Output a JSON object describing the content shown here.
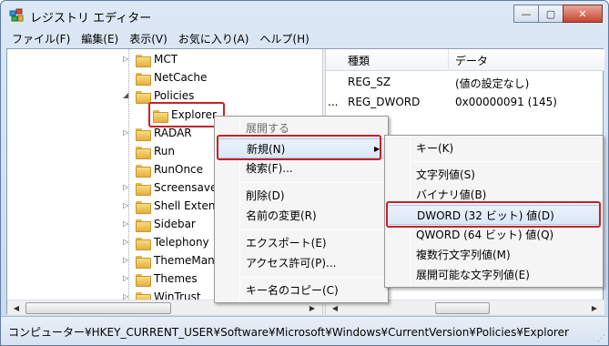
{
  "window": {
    "title": "レジストリ エディター",
    "buttons": {
      "minimize": "—",
      "maximize": "▢",
      "close": "✕"
    }
  },
  "menubar": [
    "ファイル(F)",
    "編集(E)",
    "表示(V)",
    "お気に入り(A)",
    "ヘルプ(H)"
  ],
  "tree": {
    "items": [
      {
        "label": "MCT",
        "expander": "▷"
      },
      {
        "label": "NetCache",
        "expander": ""
      },
      {
        "label": "Policies",
        "expander": "◢"
      },
      {
        "label": "Explorer",
        "expander": ""
      },
      {
        "label": "RADAR",
        "expander": "▷"
      },
      {
        "label": "Run",
        "expander": ""
      },
      {
        "label": "RunOnce",
        "expander": ""
      },
      {
        "label": "Screensave",
        "expander": "▷"
      },
      {
        "label": "Shell Extens",
        "expander": "▷"
      },
      {
        "label": "Sidebar",
        "expander": "▷"
      },
      {
        "label": "Telephony",
        "expander": "▷"
      },
      {
        "label": "ThemeMana",
        "expander": "▷"
      },
      {
        "label": "Themes",
        "expander": "▷"
      },
      {
        "label": "WinTrust",
        "expander": "▷"
      }
    ]
  },
  "list": {
    "columns": [
      "種類",
      "データ"
    ],
    "rows": [
      {
        "name": "",
        "type": "REG_SZ",
        "data": "(値の設定なし)"
      },
      {
        "name": "...",
        "type": "REG_DWORD",
        "data": "0x00000091 (145)"
      }
    ]
  },
  "context_menu": {
    "items": [
      "展開する",
      "新規(N)",
      "検索(F)...",
      "削除(D)",
      "名前の変更(R)",
      "エクスポート(E)",
      "アクセス許可(P)...",
      "キー名のコピー(C)"
    ],
    "submenu_arrow": "▶"
  },
  "submenu": {
    "items": [
      "キー(K)",
      "文字列値(S)",
      "バイナリ値(B)",
      "DWORD (32 ビット) 値(D)",
      "QWORD (64 ビット) 値(Q)",
      "複数行文字列値(M)",
      "展開可能な文字列値(E)"
    ]
  },
  "statusbar": {
    "path": "コンピューター¥HKEY_CURRENT_USER¥Software¥Microsoft¥Windows¥CurrentVersion¥Policies¥Explorer"
  },
  "scroll": {
    "left": "◀",
    "right": "▶"
  },
  "colors": {
    "highlight": "#c8202a",
    "folder": "#f0c850"
  }
}
